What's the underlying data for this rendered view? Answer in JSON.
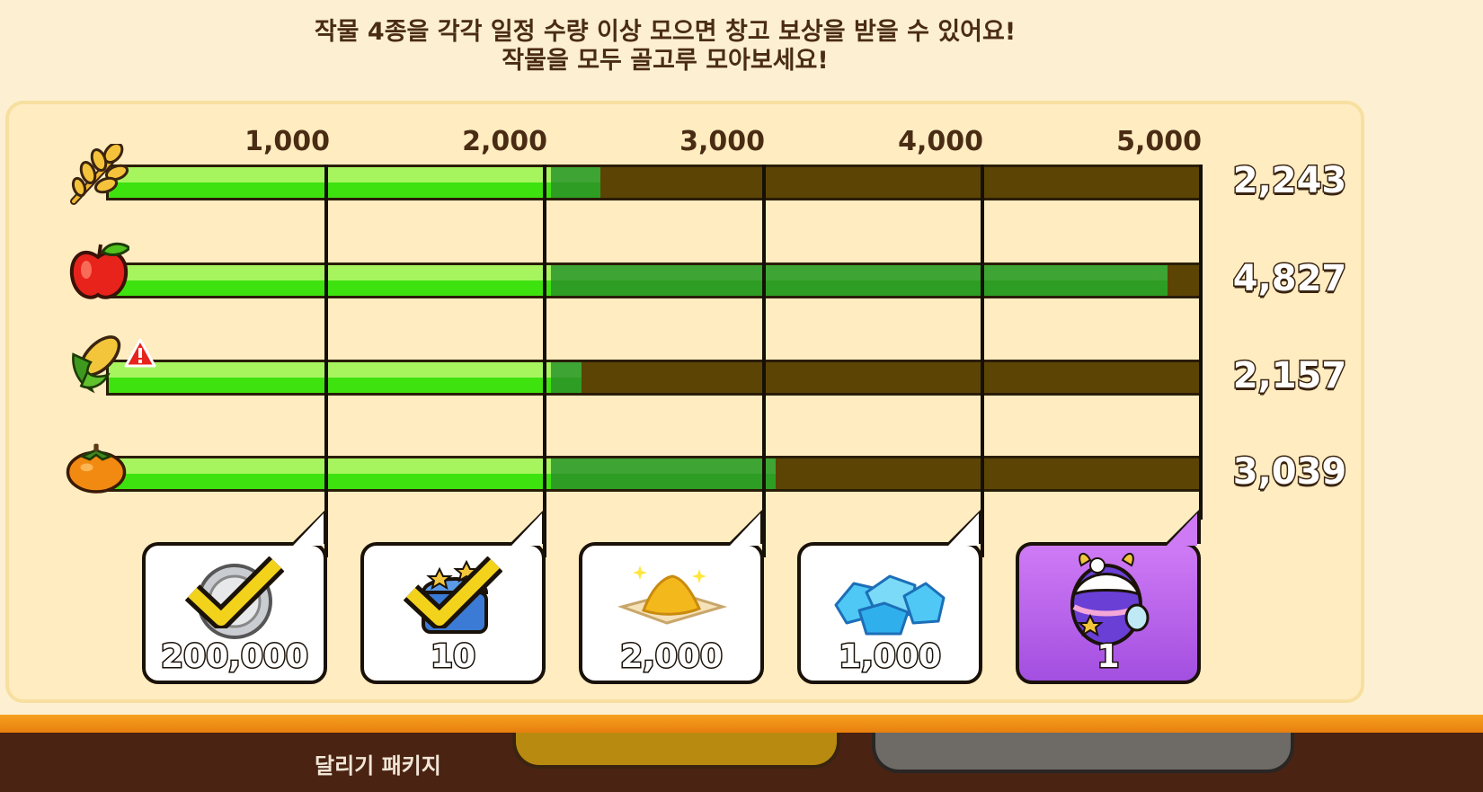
{
  "message": {
    "line1": "작물 4종을 각각 일정 수량 이상 모으면 창고 보상을 받을 수 있어요!",
    "line2": "작물을 모두 골고루 모아보세요!"
  },
  "milestones": [
    "1,000",
    "2,000",
    "3,000",
    "4,000",
    "5,000"
  ],
  "crops": [
    {
      "icon": "wheat-icon",
      "value_text": "2,243",
      "value": 2243,
      "warning": false
    },
    {
      "icon": "apple-icon",
      "value_text": "4,827",
      "value": 4827,
      "warning": false
    },
    {
      "icon": "corn-icon",
      "value_text": "2,157",
      "value": 2157,
      "warning": true
    },
    {
      "icon": "persimmon-icon",
      "value_text": "3,039",
      "value": 3039,
      "warning": false
    }
  ],
  "scale_max": 5000,
  "rewards": [
    {
      "icon": "coin-icon",
      "amount": "200,000",
      "claimed": true
    },
    {
      "icon": "treasure-chest-icon",
      "amount": "10",
      "claimed": true
    },
    {
      "icon": "gold-sand-icon",
      "amount": "2,000",
      "claimed": false
    },
    {
      "icon": "crystal-icon",
      "amount": "1,000",
      "claimed": false
    },
    {
      "icon": "decorated-egg-icon",
      "amount": "1",
      "claimed": false
    }
  ],
  "footer": {
    "package_label": "달리기 패키지"
  },
  "colors": {
    "bar_empty": "#5c4405",
    "bar_fill_light": "#a6f55f",
    "bar_fill": "#3ee20f",
    "bar_fill_dark": "#2e9d23",
    "special_card": "#b35fe8"
  }
}
